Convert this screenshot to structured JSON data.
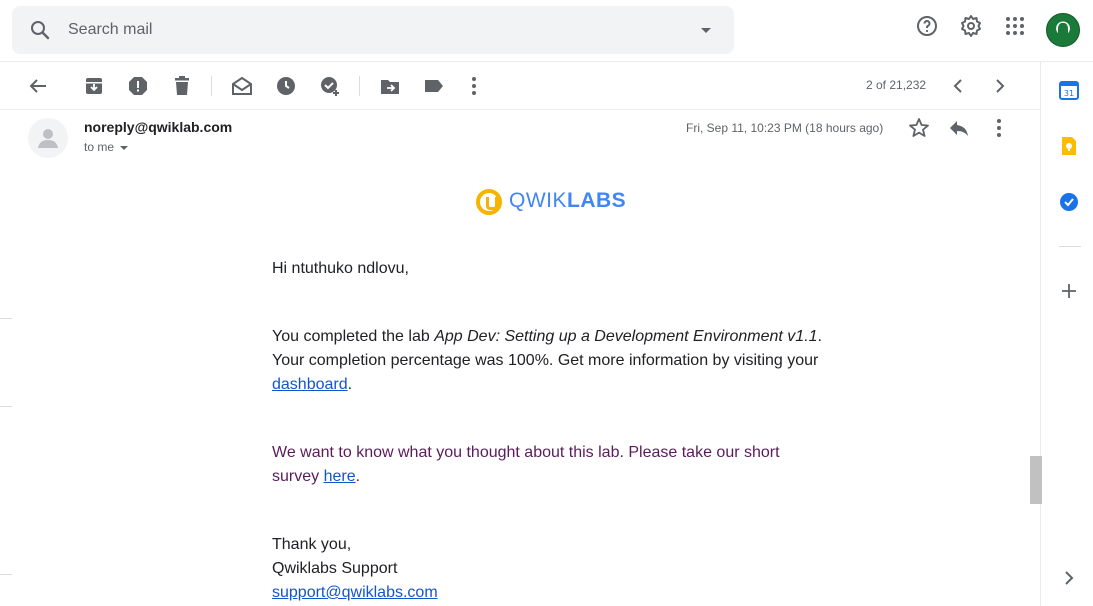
{
  "search": {
    "placeholder": "Search mail"
  },
  "pager": {
    "text": "2 of 21,232"
  },
  "message": {
    "sender": "noreply@qwiklab.com",
    "to": "to me",
    "date": "Fri, Sep 11, 10:23 PM (18 hours ago)"
  },
  "logo": {
    "light": "QWIK",
    "bold": "LABS"
  },
  "email": {
    "greeting": "Hi ntuthuko ndlovu,",
    "p1_prefix": "You completed the lab ",
    "p1_lab": "App Dev: Setting up a Development Environment v1.1",
    "p1_suffix": ".",
    "p1_line2": "Your completion percentage was 100%. Get more information by visiting your",
    "p1_link": "dashboard",
    "p1_end": ".",
    "p2_line1": "We want to know what you thought about this lab. Please take our short",
    "p2_prefix": "survey ",
    "p2_link": "here",
    "p2_end": ".",
    "sig1": "Thank you,",
    "sig2": "Qwiklabs Support",
    "sig_email": "support@qwiklabs.com"
  },
  "icons": {
    "topbar": [
      "search-icon",
      "dropdown-icon",
      "help-icon",
      "settings-icon",
      "apps-icon",
      "account-avatar"
    ],
    "toolbar": [
      "back-icon",
      "archive-icon",
      "report-spam-icon",
      "delete-icon",
      "mark-unread-icon",
      "snooze-icon",
      "add-task-icon",
      "move-to-icon",
      "label-icon",
      "more-icon",
      "prev-icon",
      "next-icon"
    ],
    "side": [
      "calendar-icon",
      "keep-icon",
      "tasks-icon",
      "add-icon",
      "expand-icon"
    ]
  },
  "colors": {
    "link": "#1155cc",
    "survey_text": "#5b1b5b",
    "logo_blue": "#4285f4",
    "logo_yellow": "#f4b400"
  }
}
